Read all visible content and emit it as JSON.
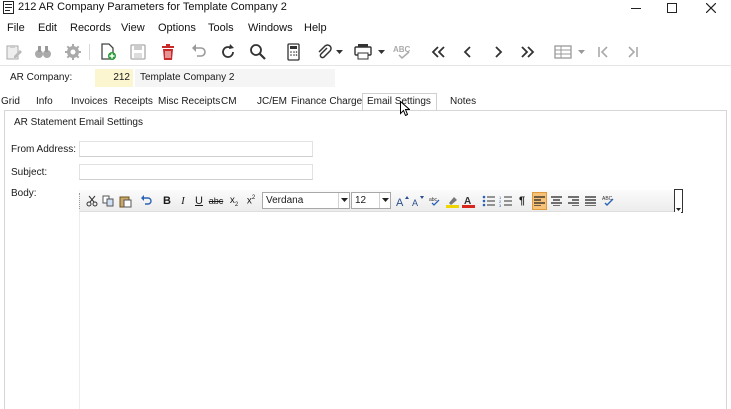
{
  "window": {
    "title": "212 AR Company Parameters for Template Company 2",
    "controls": [
      "minimize-icon",
      "maximize-icon",
      "close-icon"
    ]
  },
  "menu": [
    "File",
    "Edit",
    "Records",
    "View",
    "Options",
    "Tools",
    "Windows",
    "Help"
  ],
  "toolbar_icons": [
    "edit-record-icon",
    "find-binoculars-icon",
    "settings-gear-icon",
    "new-record-icon",
    "save-icon",
    "delete-icon",
    "undo-icon",
    "refresh-icon",
    "search-icon",
    "calculator-icon",
    "attachment-icon",
    "print-icon",
    "spellcheck-icon",
    "first-record-icon",
    "previous-record-icon",
    "next-record-icon",
    "last-record-icon",
    "grid-layout-icon",
    "first-page-icon",
    "last-page-icon"
  ],
  "company": {
    "label": "AR Company:",
    "code": "212",
    "name": "Template Company 2"
  },
  "tabs": [
    {
      "label": "Grid",
      "active": false
    },
    {
      "label": "Info",
      "active": false
    },
    {
      "label": "Invoices",
      "active": false
    },
    {
      "label": "Receipts",
      "active": false
    },
    {
      "label": "Misc Receipts",
      "active": false
    },
    {
      "label": "CM",
      "active": false
    },
    {
      "label": "JC/EM",
      "active": false
    },
    {
      "label": "Finance Charges",
      "active": false
    },
    {
      "label": "Email Settings",
      "active": true
    },
    {
      "label": "Notes",
      "active": false
    }
  ],
  "email_settings": {
    "section_title": "AR Statement Email Settings",
    "from_label": "From Address:",
    "from_value": "",
    "subject_label": "Subject:",
    "subject_value": "",
    "body_label": "Body:",
    "body_value": ""
  },
  "editor": {
    "font_family": "Verdana",
    "font_size": "12",
    "buttons": [
      "cut-icon",
      "copy-icon",
      "paste-icon",
      "undo-icon",
      "bold-icon",
      "italic-icon",
      "underline-icon",
      "strikethrough-icon",
      "subscript-icon",
      "superscript-icon",
      "grow-font-icon",
      "shrink-font-icon",
      "spellcheck-icon",
      "highlight-icon",
      "font-color-icon",
      "bullet-list-icon",
      "numbered-list-icon",
      "paragraph-mark-icon",
      "align-left-icon",
      "align-center-icon",
      "align-right-icon",
      "justify-icon",
      "spell-check-all-icon"
    ],
    "active_alignment": "left"
  },
  "colors": {
    "company_code_background": "#fbf6cf",
    "active_alignment": "#f6c277",
    "highlight": "#f0d600",
    "font_color": "#d9261c"
  }
}
